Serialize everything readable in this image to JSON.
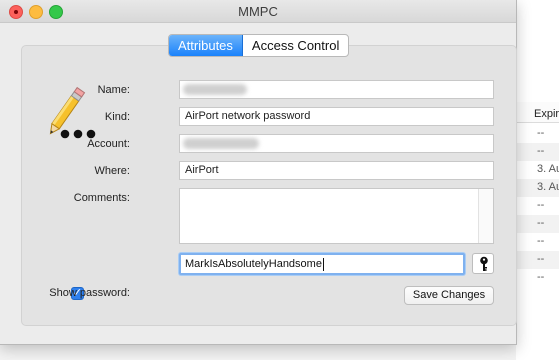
{
  "window": {
    "title": "MMPC"
  },
  "tabs": [
    {
      "label": "Attributes",
      "active": true
    },
    {
      "label": "Access Control",
      "active": false
    }
  ],
  "fields": {
    "name": {
      "label": "Name:",
      "value": ""
    },
    "kind": {
      "label": "Kind:",
      "value": "AirPort network password"
    },
    "account": {
      "label": "Account:",
      "value": ""
    },
    "where": {
      "label": "Where:",
      "value": "AirPort"
    },
    "comments": {
      "label": "Comments:",
      "value": ""
    }
  },
  "show_password": {
    "label": "Show password:",
    "checked": true,
    "value": "MarkIsAbsolutelyHandsome"
  },
  "buttons": {
    "save": "Save Changes"
  },
  "background_list": {
    "header": "Expir",
    "rows": [
      "--",
      "--",
      "3. Au",
      "3. Au",
      "--",
      "--",
      "--",
      "--",
      "--"
    ]
  },
  "colors": {
    "accent": "#1a82fb",
    "close": "#fc605b",
    "minimize": "#fdbc40",
    "zoom": "#34c84a"
  }
}
